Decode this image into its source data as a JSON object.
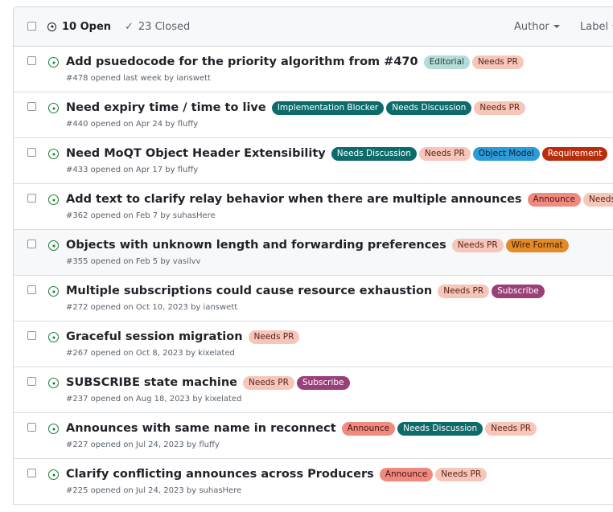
{
  "header": {
    "open_count_label": "10 Open",
    "closed_count_label": "23 Closed",
    "author_filter": "Author",
    "label_filter": "Label"
  },
  "label_styles": {
    "Editorial": {
      "bg": "#b5dcd8",
      "fg": "#1f3a37"
    },
    "Needs PR": {
      "bg": "#f7c6bb",
      "fg": "#5a1f12"
    },
    "Implementation Blocker": {
      "bg": "#0e6b6b",
      "fg": "#ffffff"
    },
    "Needs Discussion": {
      "bg": "#0e6b6b",
      "fg": "#ffffff"
    },
    "Object Model": {
      "bg": "#2c9bd8",
      "fg": "#0b2233"
    },
    "Requirement": {
      "bg": "#b82d0c",
      "fg": "#ffffff"
    },
    "Announce": {
      "bg": "#f08a80",
      "fg": "#4a120c"
    },
    "Wire Format": {
      "bg": "#e48a27",
      "fg": "#3a1d02"
    },
    "Subscribe": {
      "bg": "#9b3e79",
      "fg": "#ffffff"
    }
  },
  "issues": [
    {
      "title": "Add psuedocode for the priority algorithm from #470",
      "labels": [
        "Editorial",
        "Needs PR"
      ],
      "meta": "#478 opened last week by ianswett"
    },
    {
      "title": "Need expiry time / time to live",
      "labels": [
        "Implementation Blocker",
        "Needs Discussion",
        "Needs PR"
      ],
      "meta": "#440 opened on Apr 24 by fluffy"
    },
    {
      "title": "Need MoQT Object Header Extensibility",
      "labels": [
        "Needs Discussion",
        "Needs PR",
        "Object Model",
        "Requirement"
      ],
      "meta": "#433 opened on Apr 17 by fluffy"
    },
    {
      "title": "Add text to clarify relay behavior when there are multiple announces",
      "labels": [
        "Announce",
        "Needs PR"
      ],
      "meta": "#362 opened on Feb 7 by suhasHere"
    },
    {
      "title": "Objects with unknown length and forwarding preferences",
      "labels": [
        "Needs PR",
        "Wire Format"
      ],
      "meta": "#355 opened on Feb 5 by vasilvv",
      "hovered": true
    },
    {
      "title": "Multiple subscriptions could cause resource exhaustion",
      "labels": [
        "Needs PR",
        "Subscribe"
      ],
      "meta": "#272 opened on Oct 10, 2023 by ianswett"
    },
    {
      "title": "Graceful session migration",
      "labels": [
        "Needs PR"
      ],
      "meta": "#267 opened on Oct 8, 2023 by kixelated"
    },
    {
      "title": "SUBSCRIBE state machine",
      "labels": [
        "Needs PR",
        "Subscribe"
      ],
      "meta": "#237 opened on Aug 18, 2023 by kixelated"
    },
    {
      "title": "Announces with same name in reconnect",
      "labels": [
        "Announce",
        "Needs Discussion",
        "Needs PR"
      ],
      "meta": "#227 opened on Jul 24, 2023 by fluffy"
    },
    {
      "title": "Clarify conflicting announces across Producers",
      "labels": [
        "Announce",
        "Needs PR"
      ],
      "meta": "#225 opened on Jul 24, 2023 by suhasHere"
    }
  ]
}
